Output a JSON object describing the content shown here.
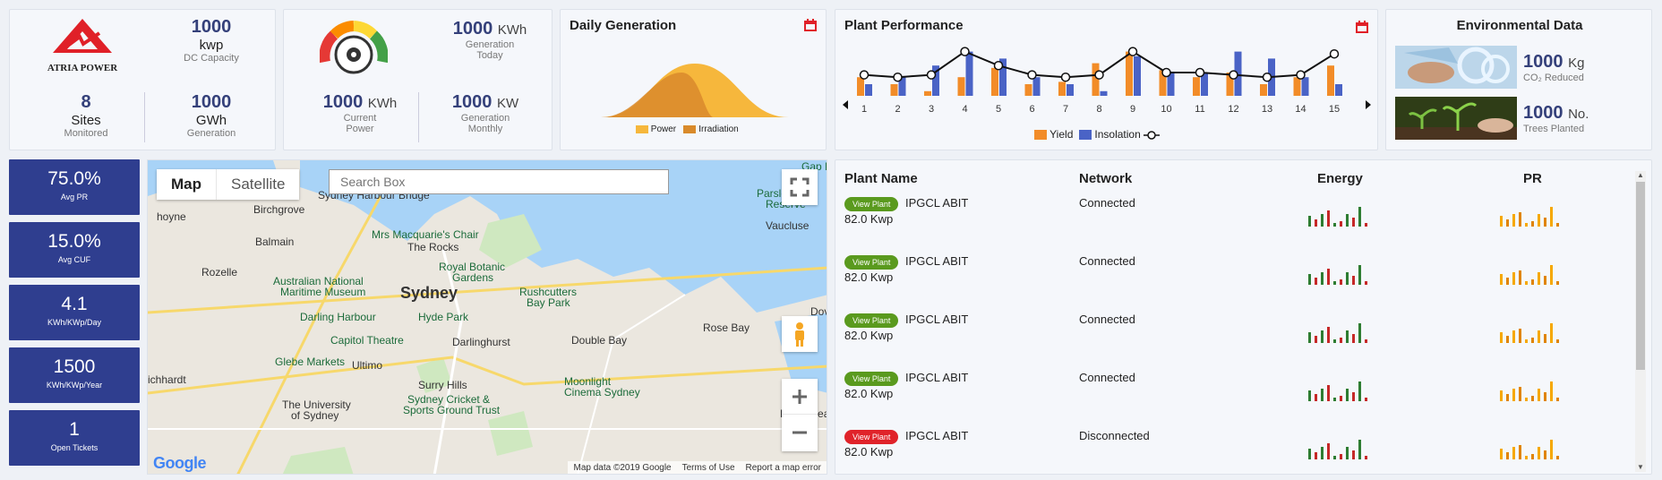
{
  "summary": {
    "brand": "ATRIA POWER",
    "capacity_value": "1000",
    "capacity_unit": "kwp",
    "capacity_label": "DC Capacity",
    "sites_value": "8",
    "sites_unit": "Sites",
    "sites_label": "Monitored",
    "gen_value": "1000",
    "gen_unit": "GWh",
    "gen_label": "Generation"
  },
  "power": {
    "today_value": "1000",
    "today_unit": "KWh",
    "today_label1": "Generation",
    "today_label2": "Today",
    "current_value": "1000",
    "current_unit": "KWh",
    "current_label1": "Current",
    "current_label2": "Power",
    "monthly_value": "1000",
    "monthly_unit": "KW",
    "monthly_label1": "Generation",
    "monthly_label2": "Monthly"
  },
  "daily": {
    "title": "Daily Generation",
    "legend_power": "Power",
    "legend_irradiation": "Irradiation"
  },
  "performance": {
    "title": "Plant Performance",
    "legend_yield": "Yield",
    "legend_insolation": "Insolation"
  },
  "chart_data": {
    "type": "bar",
    "categories": [
      "1",
      "2",
      "3",
      "4",
      "5",
      "6",
      "7",
      "8",
      "9",
      "10",
      "11",
      "12",
      "13",
      "14",
      "15"
    ],
    "series": [
      {
        "name": "Yield",
        "values": [
          40,
          25,
          10,
          40,
          60,
          25,
          30,
          70,
          95,
          55,
          40,
          50,
          25,
          40,
          65
        ]
      },
      {
        "name": "Insolation",
        "values": [
          25,
          40,
          65,
          95,
          80,
          40,
          25,
          10,
          85,
          50,
          50,
          95,
          80,
          40,
          25
        ]
      },
      {
        "name": "Line",
        "values": [
          45,
          40,
          45,
          95,
          65,
          45,
          40,
          45,
          95,
          50,
          50,
          45,
          40,
          45,
          90
        ]
      }
    ],
    "colors": {
      "yield": "#f28c28",
      "insolation": "#4a63c6"
    }
  },
  "environment": {
    "title": "Environmental Data",
    "co2_value": "1000",
    "co2_unit": "Kg",
    "co2_label": "CO₂ Reduced",
    "trees_value": "1000",
    "trees_unit": "No.",
    "trees_label": "Trees Planted"
  },
  "kpis": [
    {
      "value": "75.0%",
      "label": "Avg PR"
    },
    {
      "value": "15.0%",
      "label": "Avg CUF"
    },
    {
      "value": "4.1",
      "label": "KWh/KWp/Day"
    },
    {
      "value": "1500",
      "label": "KWh/KWp/Year"
    },
    {
      "value": "1",
      "label": "Open Tickets"
    }
  ],
  "map": {
    "tab_map": "Map",
    "tab_satellite": "Satellite",
    "search_placeholder": "Search Box",
    "google": "Google",
    "attribution": "Map data ©2019 Google",
    "terms": "Terms of Use",
    "report": "Report a map error",
    "labels": [
      "Sydney Harbour Bridge",
      "Birchgrove",
      "Balmain",
      "Rozelle",
      "Mrs Macquarie's Chair",
      "The Rocks",
      "Royal Botanic Gardens",
      "Sydney",
      "Australian National Maritime Museum",
      "Rushcutters Bay Park",
      "Darling Harbour",
      "Hyde Park",
      "Capitol Theatre",
      "Darlinghurst",
      "Double Bay",
      "Rose Bay",
      "Glebe Markets",
      "Ultimo",
      "Surry Hills",
      "Moonlight Cinema Sydney",
      "The University of Sydney",
      "Sydney Cricket & Sports Ground Trust",
      "Bondi Beach",
      "Parsley Bay Reserve",
      "Vaucluse",
      "Gap Park",
      "Dove",
      "ichhardt",
      "hoyne"
    ]
  },
  "table": {
    "col_name": "Plant Name",
    "col_network": "Network",
    "col_energy": "Energy",
    "col_pr": "PR",
    "rows": [
      {
        "button": "View Plant",
        "name": "IPGCL ABIT",
        "kwp": "82.0 Kwp",
        "network": "Connected",
        "status": "ok"
      },
      {
        "button": "View Plant",
        "name": "IPGCL ABIT",
        "kwp": "82.0 Kwp",
        "network": "Connected",
        "status": "ok"
      },
      {
        "button": "View Plant",
        "name": "IPGCL ABIT",
        "kwp": "82.0 Kwp",
        "network": "Connected",
        "status": "ok"
      },
      {
        "button": "View Plant",
        "name": "IPGCL ABIT",
        "kwp": "82.0 Kwp",
        "network": "Connected",
        "status": "ok"
      },
      {
        "button": "View Plant",
        "name": "IPGCL ABIT",
        "kwp": "82.0 Kwp",
        "network": "Disconnected",
        "status": "bad"
      }
    ]
  }
}
